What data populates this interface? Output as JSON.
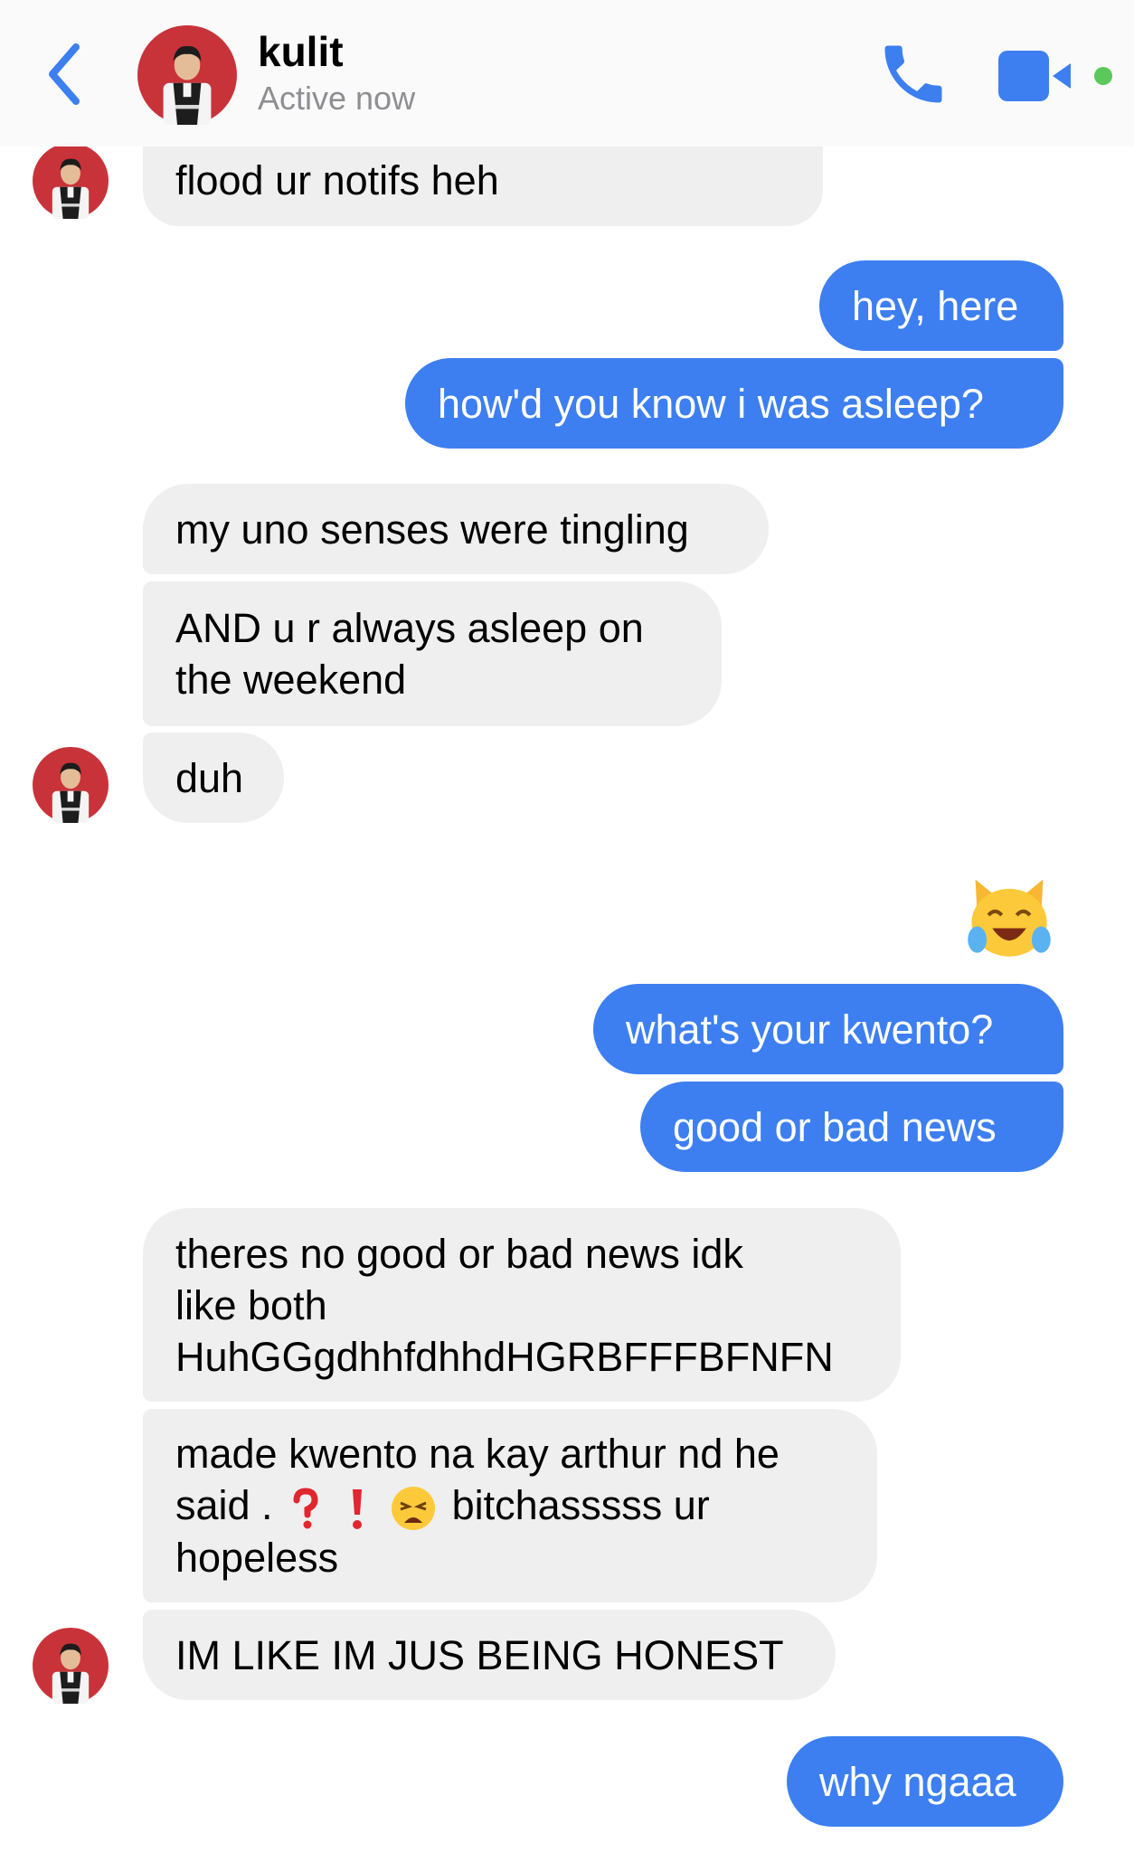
{
  "header": {
    "contact_name": "kulit",
    "status": "Active now"
  },
  "messages": {
    "m1": "flood ur notifs heh",
    "m2": "hey, here",
    "m3": "how'd you know i was asleep?",
    "m4": "my uno senses were tingling",
    "m5_l1": "AND u r always asleep on",
    "m5_l2": "the weekend",
    "m6": "duh",
    "m7": "what's your kwento?",
    "m8": "good or bad news",
    "m9_l1": "theres no good or bad news idk",
    "m9_l2": "like both",
    "m9_l3": "HuhGGgdhhfdhhdHGRBFFFBFNFN",
    "m10_l1": "made kwento na kay arthur nd he",
    "m10_l2_a": "said .",
    "m10_l2_b": "bitchasssss ur",
    "m10_l3": "hopeless",
    "m11": "IM LIKE IM JUS BEING HONEST",
    "m12": "why ngaaa"
  },
  "icons": {
    "back": "chevron-left-icon",
    "call": "phone-icon",
    "video": "video-camera-icon",
    "sticker": "cat-tears-of-joy-emoji",
    "inline_emojis": [
      "red-question-mark-emoji",
      "red-exclamation-mark-emoji",
      "weary-face-emoji"
    ]
  },
  "colors": {
    "accent": "#3d7ff0",
    "incoming_bubble": "#efefef",
    "online": "#5ac85a",
    "avatar_bg": "#c8333a"
  }
}
